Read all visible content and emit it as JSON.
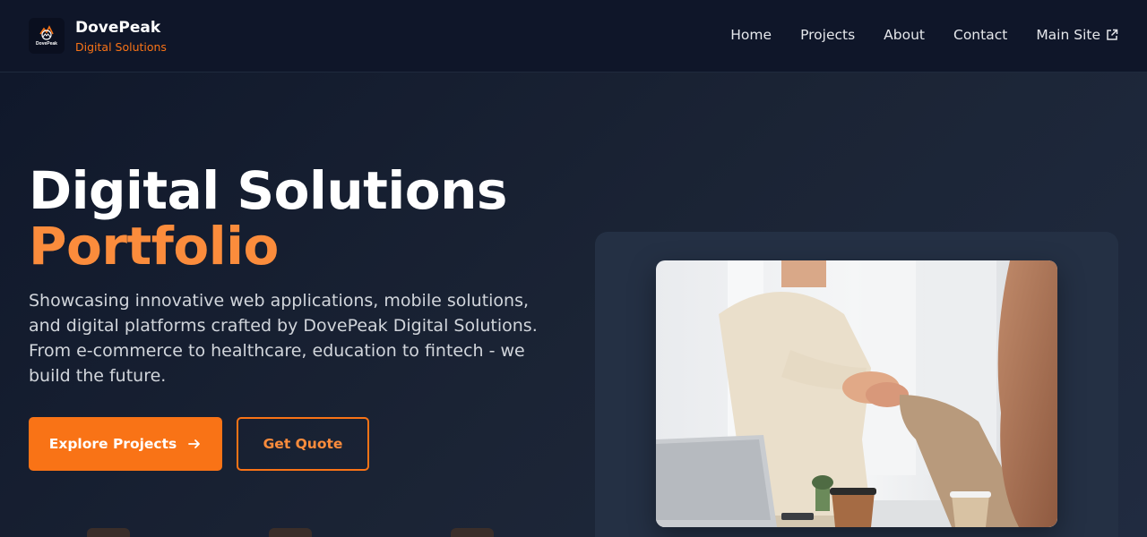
{
  "header": {
    "brand_name": "DovePeak",
    "brand_tagline": "Digital Solutions",
    "logo_icon": "dovepeak-logo-icon",
    "logo_text": "DovePeak",
    "nav": [
      {
        "label": "Home"
      },
      {
        "label": "Projects"
      },
      {
        "label": "About"
      },
      {
        "label": "Contact"
      },
      {
        "label": "Main Site",
        "icon": "external-link-icon"
      }
    ]
  },
  "hero": {
    "title": "Digital Solutions",
    "title_accent": "Portfolio",
    "description": "Showcasing innovative web applications, mobile solutions, and digital platforms crafted by DovePeak Digital Solutions. From e-commerce to healthcare, education to fintech - we build the future.",
    "primary_cta": {
      "label": "Explore Projects",
      "icon": "arrow-right-icon"
    },
    "secondary_cta": {
      "label": "Get Quote"
    }
  },
  "image": {
    "subject": "business-handshake-photo"
  },
  "colors": {
    "accent": "#f97316",
    "background": "#0f172a",
    "header": "#0f1629",
    "card": "#243044"
  }
}
